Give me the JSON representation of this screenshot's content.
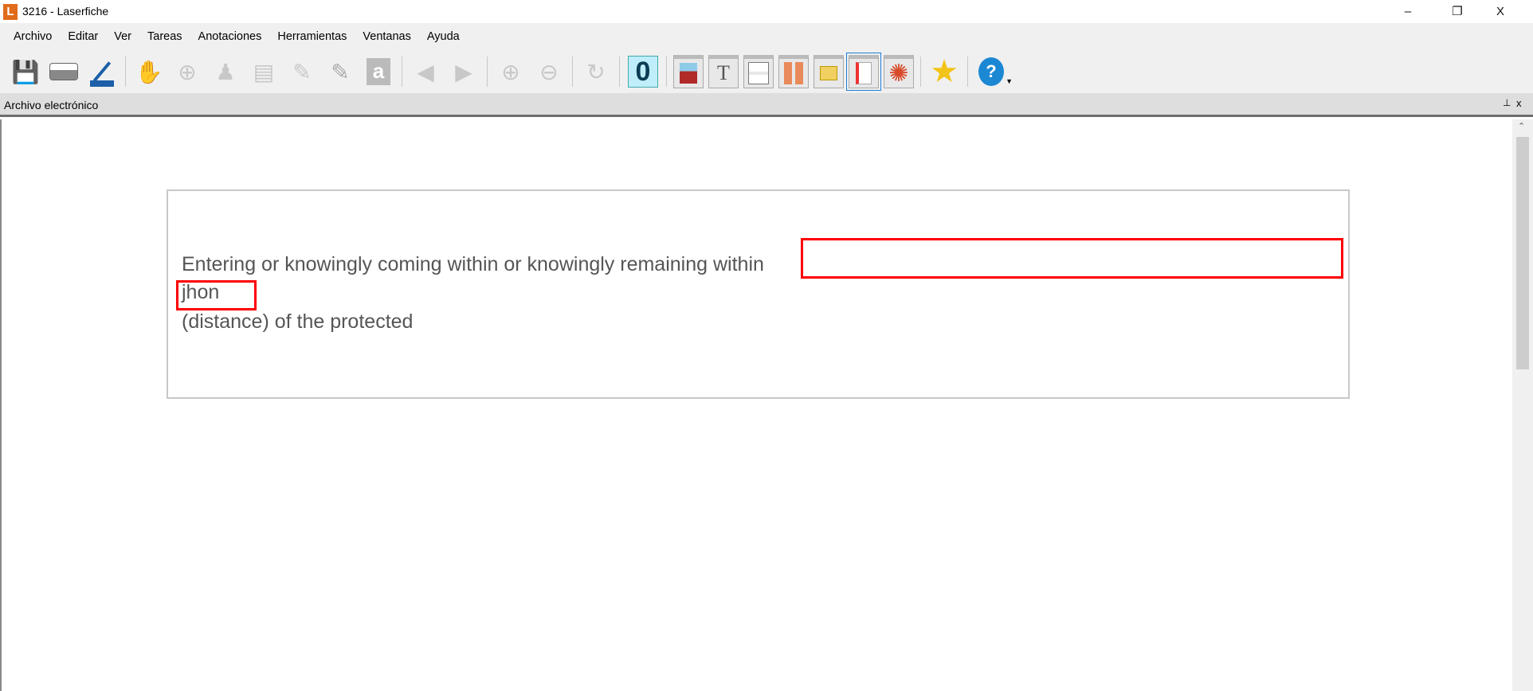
{
  "window": {
    "logo": "L",
    "title": "3216 - Laserfiche",
    "minimize": "–",
    "restore": "❐",
    "close": "X"
  },
  "menu": [
    "Archivo",
    "Editar",
    "Ver",
    "Tareas",
    "Anotaciones",
    "Herramientas",
    "Ventanas",
    "Ayuda"
  ],
  "panel": {
    "title": "Archivo electrónico",
    "pin": "📌",
    "close": "x"
  },
  "document": {
    "lines": [
      "Entering or knowingly coming within or knowingly remaining within",
      "jhon",
      "(distance) of the protected"
    ]
  },
  "toolbar": {
    "help": "?",
    "text_glyph": "T",
    "letter_glyph": "a",
    "ocr_glyph": "0"
  }
}
